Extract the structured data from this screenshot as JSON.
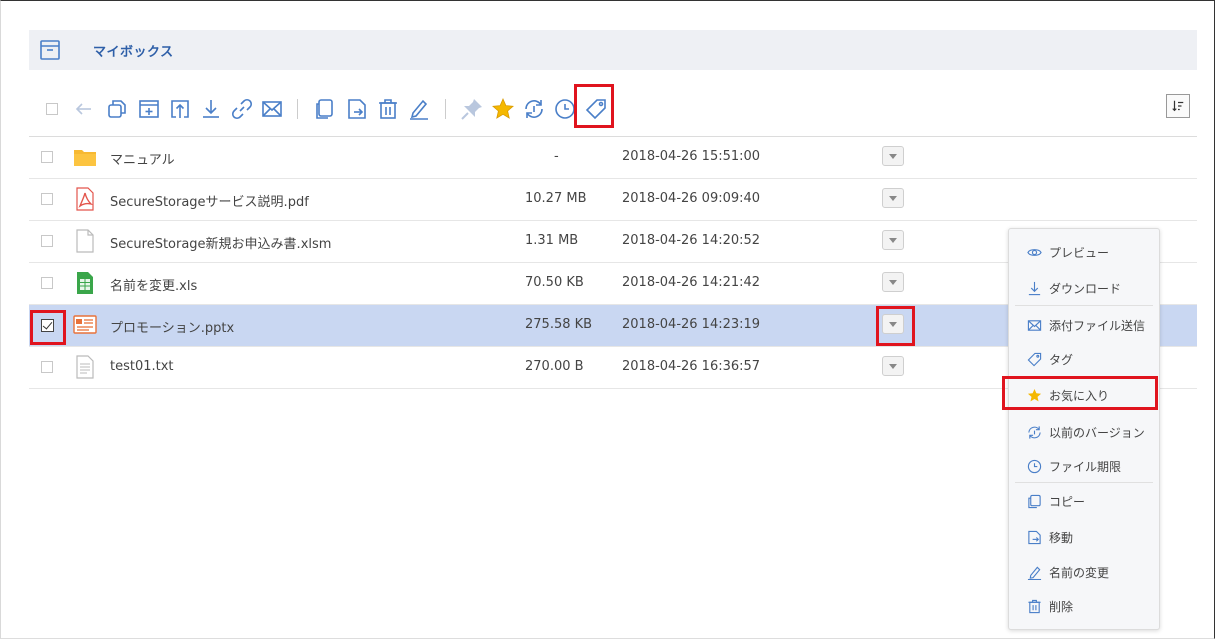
{
  "header": {
    "title": "マイボックス",
    "icon": "archive-box-icon"
  },
  "toolbar": {
    "icons": [
      "back-arrow-icon",
      "copy-icon",
      "new-folder-icon",
      "upload-icon",
      "download-icon",
      "link-icon",
      "mail-icon",
      "copy-file-icon",
      "move-file-icon",
      "trash-icon",
      "rename-icon",
      "pin-icon",
      "star-icon",
      "version-icon",
      "clock-icon",
      "tag-icon",
      "sort-icon"
    ]
  },
  "files": [
    {
      "name": "マニュアル",
      "size": "-",
      "date": "2018-04-26 15:51:00",
      "type": "folder",
      "checked": false
    },
    {
      "name": "SecureStorageサービス説明.pdf",
      "size": "10.27 MB",
      "date": "2018-04-26 09:09:40",
      "type": "pdf",
      "checked": false
    },
    {
      "name": "SecureStorage新規お申込み書.xlsm",
      "size": "1.31 MB",
      "date": "2018-04-26 14:20:52",
      "type": "generic",
      "checked": false
    },
    {
      "name": "名前を変更.xls",
      "size": "70.50 KB",
      "date": "2018-04-26 14:21:42",
      "type": "excel",
      "checked": false
    },
    {
      "name": "プロモーション.pptx",
      "size": "275.58 KB",
      "date": "2018-04-26 14:23:19",
      "type": "ppt",
      "checked": true
    },
    {
      "name": "test01.txt",
      "size": "270.00 B",
      "date": "2018-04-26 16:36:57",
      "type": "text",
      "checked": false
    }
  ],
  "context_menu": {
    "items": [
      {
        "label": "プレビュー",
        "icon": "eye-icon"
      },
      {
        "label": "ダウンロード",
        "icon": "download-icon"
      },
      {
        "label": "添付ファイル送信",
        "icon": "mail-icon"
      },
      {
        "label": "タグ",
        "icon": "tag-icon"
      },
      {
        "label": "お気に入り",
        "icon": "star-icon"
      },
      {
        "label": "以前のバージョン",
        "icon": "version-icon"
      },
      {
        "label": "ファイル期限",
        "icon": "clock-icon"
      },
      {
        "label": "コピー",
        "icon": "copy-file-icon"
      },
      {
        "label": "移動",
        "icon": "move-file-icon"
      },
      {
        "label": "名前の変更",
        "icon": "rename-icon"
      },
      {
        "label": "削除",
        "icon": "trash-icon"
      }
    ]
  },
  "colors": {
    "accent": "#4a7fc8",
    "highlight": "#e0141e",
    "selected_row": "#c9d7f2",
    "star": "#f5b800"
  }
}
